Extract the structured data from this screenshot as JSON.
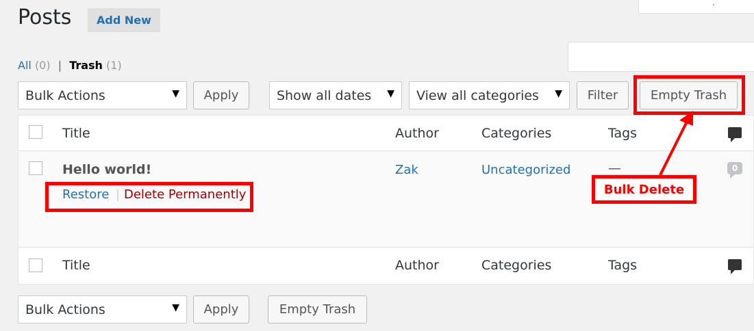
{
  "header": {
    "title": "Posts",
    "add_new": "Add New"
  },
  "views": {
    "all_label": "All",
    "all_count": "(0)",
    "separator": "|",
    "trash_label": "Trash",
    "trash_count": "(1)"
  },
  "search": {
    "placeholder": ""
  },
  "tablenav_top": {
    "bulk_actions": "Bulk Actions",
    "apply": "Apply",
    "dates": "Show all dates",
    "categories": "View all categories",
    "filter": "Filter",
    "empty_trash": "Empty Trash"
  },
  "table": {
    "columns": [
      "Title",
      "Author",
      "Categories",
      "Tags"
    ],
    "rows": [
      {
        "title": "Hello world!",
        "author": "Zak",
        "categories": "Uncategorized",
        "tags": "—",
        "comments": "0",
        "actions": {
          "restore": "Restore",
          "sep": "|",
          "delete": "Delete Permanently"
        }
      }
    ]
  },
  "tablenav_bottom": {
    "bulk_actions": "Bulk Actions",
    "apply": "Apply",
    "empty_trash": "Empty Trash"
  },
  "annotation": {
    "label": "Bulk Delete",
    "color": "#ff0000"
  },
  "icons": {
    "dropdown": "▼",
    "comments": "comment-bubble-icon"
  },
  "colors": {
    "link": "#2271b1",
    "delete": "#a00000",
    "background": "#f1f1f1"
  }
}
